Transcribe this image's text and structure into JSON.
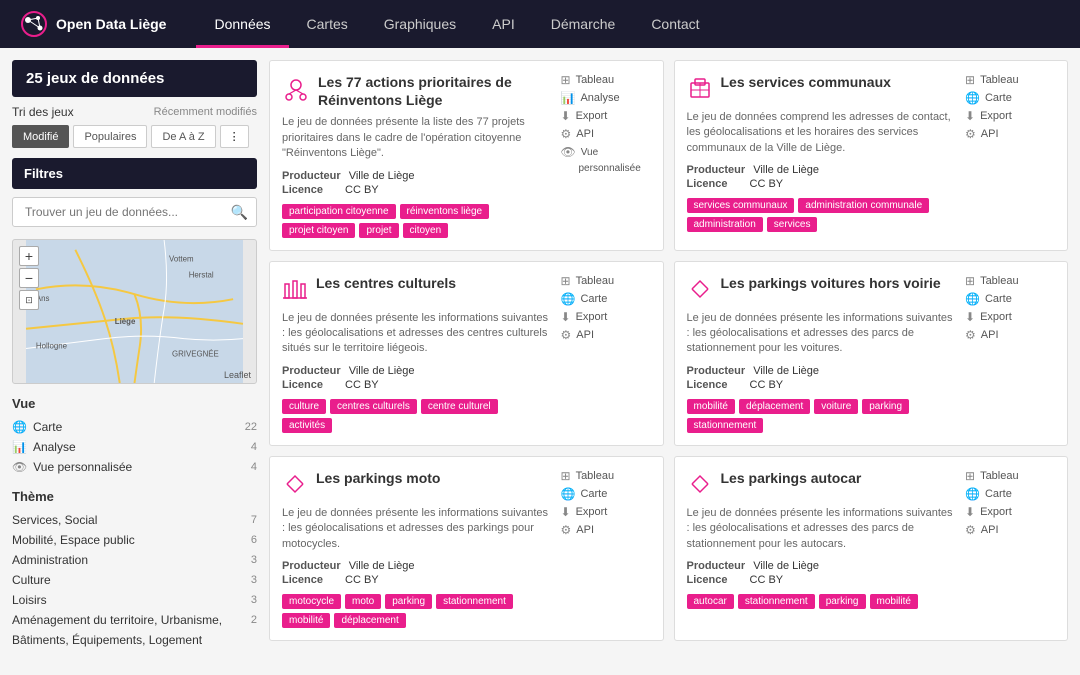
{
  "header": {
    "logo_text": "Open Data Liège",
    "nav_items": [
      {
        "label": "Données",
        "active": true
      },
      {
        "label": "Cartes",
        "active": false
      },
      {
        "label": "Graphiques",
        "active": false
      },
      {
        "label": "API",
        "active": false
      },
      {
        "label": "Démarche",
        "active": false
      },
      {
        "label": "Contact",
        "active": false
      }
    ]
  },
  "sidebar": {
    "count_label": "25 jeux de données",
    "sort_label": "Tri des jeux",
    "sort_recent": "Récemment modifiés",
    "sort_buttons": [
      {
        "label": "Modifié",
        "active": true
      },
      {
        "label": "Populaires",
        "active": false
      },
      {
        "label": "De A à Z",
        "active": false
      }
    ],
    "filters_title": "Filtres",
    "search_placeholder": "Trouver un jeu de données...",
    "vue_section_title": "Vue",
    "vue_items": [
      {
        "label": "Carte",
        "count": "22"
      },
      {
        "label": "Analyse",
        "count": "4"
      },
      {
        "label": "Vue personnalisée",
        "count": "4"
      }
    ],
    "theme_section_title": "Thème",
    "theme_items": [
      {
        "label": "Services, Social",
        "count": "7"
      },
      {
        "label": "Mobilité, Espace public",
        "count": "6"
      },
      {
        "label": "Administration",
        "count": "3"
      },
      {
        "label": "Culture",
        "count": "3"
      },
      {
        "label": "Loisirs",
        "count": "3"
      },
      {
        "label": "Aménagement du territoire, Urbanisme,",
        "count": "2"
      },
      {
        "label": "Bâtiments, Équipements, Logement",
        "count": ""
      }
    ],
    "map_labels": [
      "Vottem",
      "Herstal",
      "Ans",
      "Hollogne",
      "Liège",
      "GRIVEGNÉE"
    ]
  },
  "datasets": [
    {
      "id": "reinventons",
      "title": "Les 77 actions prioritaires de Réinventons Liège",
      "desc": "Le jeu de données présente la liste des 77 projets prioritaires dans le cadre de l'opération citoyenne \"Réinventons Liège\".",
      "producteur": "Ville de Liège",
      "licence": "CC BY",
      "tags": [
        "participation citoyenne",
        "réinventons liège",
        "projet citoyen",
        "projet",
        "citoyen"
      ],
      "icon": "people",
      "actions": [
        "Tableau",
        "Analyse",
        "Export",
        "API",
        "Vue personnalisée"
      ]
    },
    {
      "id": "services-communaux",
      "title": "Les services communaux",
      "desc": "Le jeu de données comprend les adresses de contact, les géolocalisations et les horaires des services communaux de la Ville de Liège.",
      "producteur": "Ville de Liège",
      "licence": "CC BY",
      "tags": [
        "services communaux",
        "administration communale",
        "administration",
        "services"
      ],
      "icon": "building",
      "actions": [
        "Tableau",
        "Carte",
        "Export",
        "API"
      ]
    },
    {
      "id": "centres-culturels",
      "title": "Les centres culturels",
      "desc": "Le jeu de données présente les informations suivantes : les géolocalisations et adresses des centres culturels situés sur le territoire liégeois.",
      "producteur": "Ville de Liège",
      "licence": "CC BY",
      "tags": [
        "culture",
        "centres culturels",
        "centre culturel",
        "activités"
      ],
      "icon": "columns",
      "actions": [
        "Tableau",
        "Carte",
        "Export",
        "API"
      ]
    },
    {
      "id": "parkings-voitures",
      "title": "Les parkings voitures hors voirie",
      "desc": "Le jeu de données présente les informations suivantes : les géolocalisations et adresses des parcs de stationnement pour les voitures.",
      "producteur": "Ville de Liège",
      "licence": "CC BY",
      "tags": [
        "mobilité",
        "déplacement",
        "voiture",
        "parking",
        "stationnement"
      ],
      "icon": "arrows",
      "actions": [
        "Tableau",
        "Carte",
        "Export",
        "API"
      ]
    },
    {
      "id": "parkings-moto",
      "title": "Les parkings moto",
      "desc": "Le jeu de données présente les informations suivantes : les géolocalisations et adresses des parkings pour motocycles.",
      "producteur": "Ville de Liège",
      "licence": "CC BY",
      "tags": [
        "motocycle",
        "moto",
        "parking",
        "stationnement",
        "mobilité",
        "déplacement"
      ],
      "icon": "arrows",
      "actions": [
        "Tableau",
        "Carte",
        "Export",
        "API"
      ]
    },
    {
      "id": "parkings-autocar",
      "title": "Les parkings autocar",
      "desc": "Le jeu de données présente les informations suivantes : les géolocalisations et adresses des parcs de stationnement pour les autocars.",
      "producteur": "Ville de Liège",
      "licence": "CC BY",
      "tags": [
        "autocar",
        "stationnement",
        "parking",
        "mobilité"
      ],
      "icon": "arrows",
      "actions": [
        "Tableau",
        "Carte",
        "Export",
        "API"
      ]
    }
  ],
  "action_icons": {
    "Tableau": "⊞",
    "Analyse": "📊",
    "Export": "⬇",
    "API": "⚙",
    "Carte": "🌐",
    "Vue personnalisée": "👁"
  },
  "meta_labels": {
    "producteur": "Producteur",
    "licence": "Licence"
  }
}
